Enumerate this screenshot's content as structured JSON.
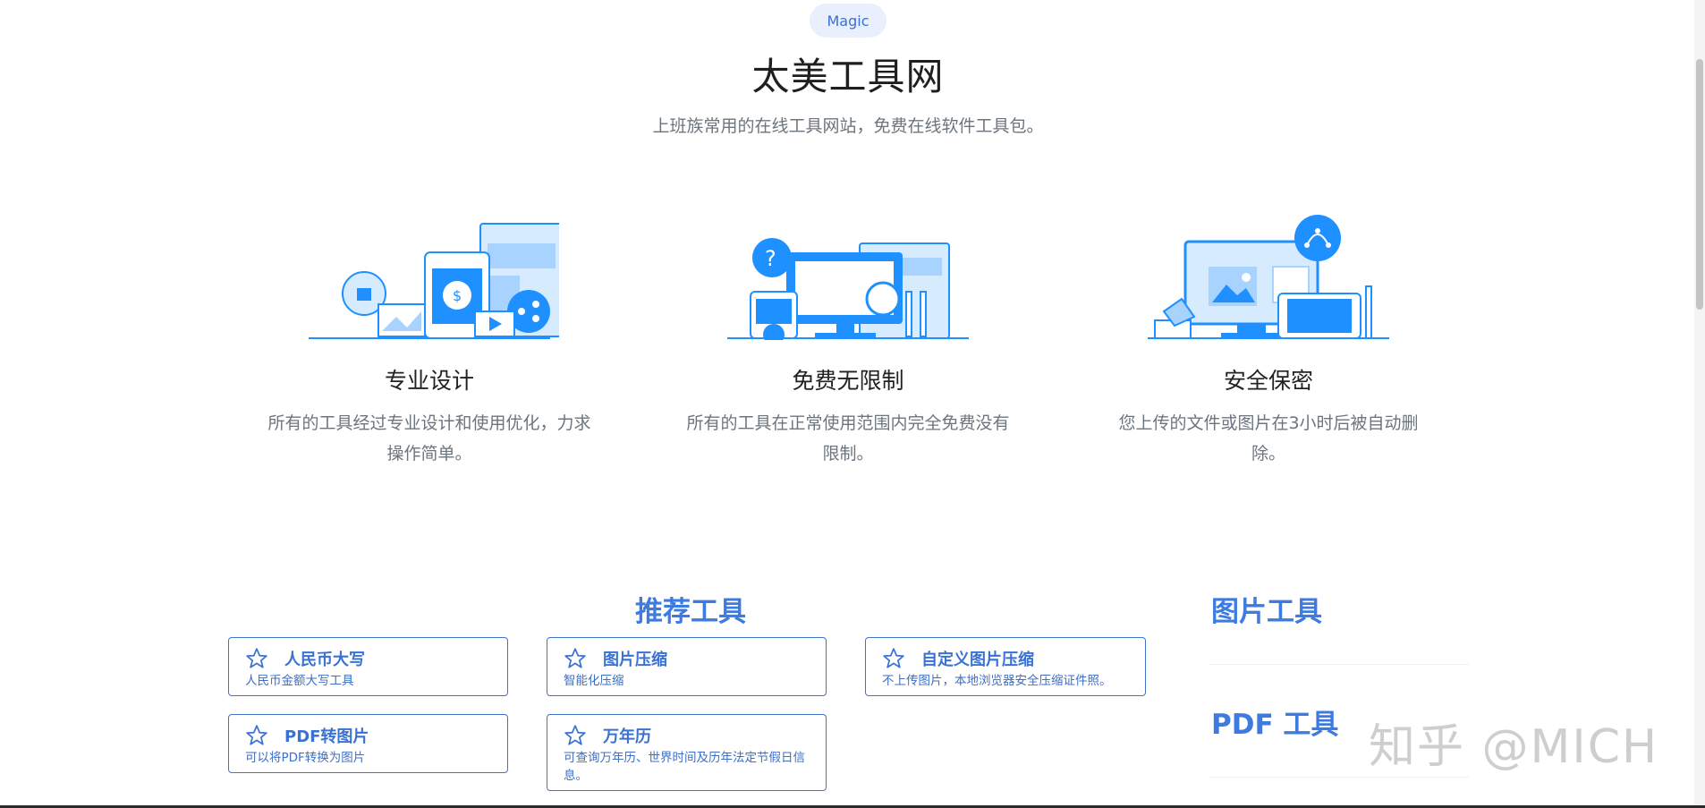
{
  "header": {
    "badge": "Magic",
    "title": "太美工具网",
    "subtitle": "上班族常用的在线工具网站，免费在线软件工具包。"
  },
  "features": [
    {
      "icon": "design-illustration",
      "title": "专业设计",
      "desc": "所有的工具经过专业设计和使用优化，力求操作简单。"
    },
    {
      "icon": "free-illustration",
      "title": "免费无限制",
      "desc": "所有的工具在正常使用范围内完全免费没有限制。"
    },
    {
      "icon": "secure-illustration",
      "title": "安全保密",
      "desc": "您上传的文件或图片在3小时后被自动删除。"
    }
  ],
  "recommend": {
    "title": "推荐工具",
    "tools": [
      {
        "name": "人民币大写",
        "desc": "人民币金额大写工具"
      },
      {
        "name": "图片压缩",
        "desc": "智能化压缩"
      },
      {
        "name": "自定义图片压缩",
        "desc": "不上传图片，本地浏览器安全压缩证件照。"
      },
      {
        "name": "PDF转图片",
        "desc": "可以将PDF转换为图片"
      },
      {
        "name": "万年历",
        "desc": "可查询万年历、世界时间及历年法定节假日信息。"
      }
    ]
  },
  "sidebar": {
    "image_tools": "图片工具",
    "pdf_tools": "PDF 工具"
  },
  "watermark": "知乎 @MICH",
  "colors": {
    "accent": "#3d7be0",
    "illustration": "#1e90ff",
    "card_border": "#3f72c8"
  }
}
